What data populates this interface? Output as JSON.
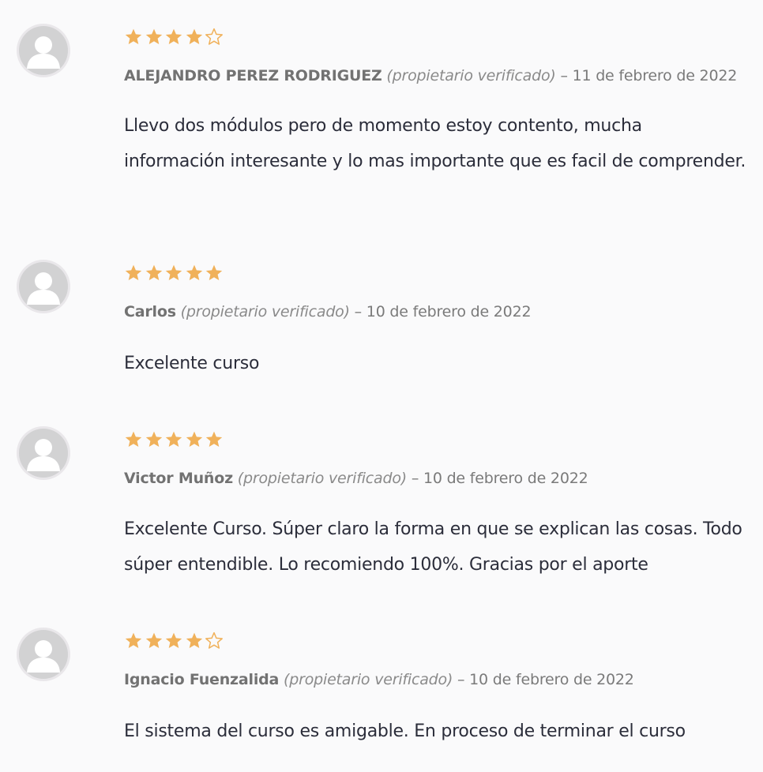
{
  "colors": {
    "background": "#fafafb",
    "star_fill": "#f0b15a",
    "star_empty": "#f0b15a",
    "avatar_bg": "#e9e7ea",
    "avatar_figure": "#c9c9ca"
  },
  "reviews": [
    {
      "rating": 4,
      "max_rating": 5,
      "author": "ALEJANDRO PEREZ RODRIGUEZ",
      "verified": "(propietario verificado)",
      "date": "– 11 de febrero de 2022",
      "text": "Llevo dos módulos pero de momento estoy contento, mucha información interesante y lo mas importante que es facil de comprender."
    },
    {
      "rating": 5,
      "max_rating": 5,
      "author": "Carlos",
      "verified": "(propietario verificado)",
      "date": "– 10 de febrero de 2022",
      "text": "Excelente curso"
    },
    {
      "rating": 5,
      "max_rating": 5,
      "author": "Victor Muñoz",
      "verified": "(propietario verificado)",
      "date": "– 10 de febrero de 2022",
      "text": "Excelente Curso. Súper claro la forma en que se explican las cosas. Todo súper entendible. Lo recomiendo 100%. Gracias por el aporte"
    },
    {
      "rating": 4,
      "max_rating": 5,
      "author": "Ignacio Fuenzalida",
      "verified": "(propietario verificado)",
      "date": "– 10 de febrero de 2022",
      "text": "El sistema del curso es amigable. En proceso de terminar el curso"
    }
  ]
}
